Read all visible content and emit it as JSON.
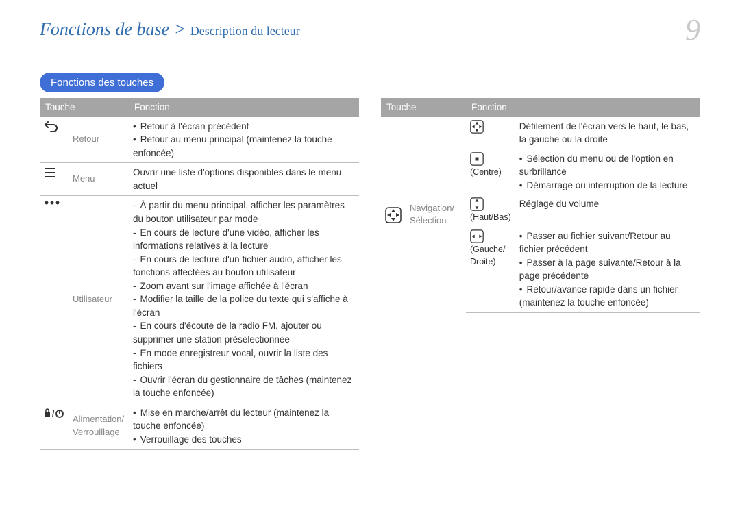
{
  "breadcrumb": {
    "main": "Fonctions de base",
    "sep": ">",
    "sub": "Description du lecteur"
  },
  "page_number": "9",
  "section_title": "Fonctions des touches",
  "left_table": {
    "headers": [
      "Touche",
      "Fonction"
    ],
    "rows": [
      {
        "name": "Retour",
        "bullets": [
          "Retour à l'écran précédent",
          "Retour au menu principal (maintenez la touche enfoncée)"
        ]
      },
      {
        "name": "Menu",
        "text": "Ouvrir une liste d'options disponibles dans le menu actuel"
      },
      {
        "name": "Utilisateur",
        "dashes": [
          "À partir du menu principal, afficher les paramètres du bouton utilisateur par mode",
          "En cours de lecture d'une vidéo, afficher les informations relatives à la lecture",
          "En cours de lecture d'un fichier audio, afficher les fonctions affectées au bouton utilisateur",
          "Zoom avant sur l'image affichée à l'écran",
          "Modifier la taille de la police du texte qui s'affiche à l'écran",
          "En cours d'écoute de la radio FM, ajouter ou supprimer une station présélectionnée",
          "En mode enregistreur vocal, ouvrir la liste des fichiers",
          "Ouvrir l'écran du gestionnaire de tâches (maintenez la touche enfoncée)"
        ]
      },
      {
        "name": "Alimentation/ Verrouillage",
        "bullets": [
          "Mise en marche/arrêt du lecteur (maintenez la touche enfoncée)",
          "Verrouillage des touches"
        ]
      }
    ]
  },
  "right_table": {
    "headers": [
      "Touche",
      "Fonction"
    ],
    "group_name": "Navigation/ Sélection",
    "rows": [
      {
        "sub": "",
        "text": "Défilement de l'écran vers le haut, le bas, la gauche ou la droite"
      },
      {
        "sub": "(Centre)",
        "bullets": [
          "Sélection du menu ou de l'option en surbrillance",
          "Démarrage ou interruption de la lecture"
        ]
      },
      {
        "sub": "(Haut/Bas)",
        "text": "Réglage du volume"
      },
      {
        "sub": "(Gauche/ Droite)",
        "bullets": [
          "Passer au fichier suivant/Retour au fichier précédent",
          "Passer à la page suivante/Retour à la page précédente",
          "Retour/avance rapide dans un fichier (maintenez la touche enfoncée)"
        ]
      }
    ]
  }
}
